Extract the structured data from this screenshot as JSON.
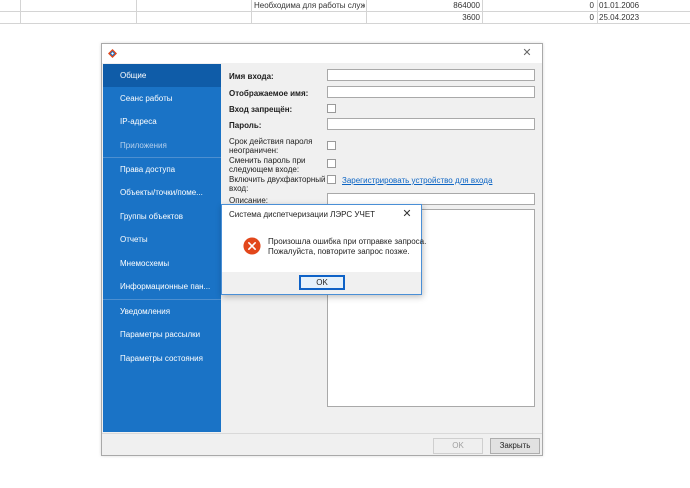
{
  "background_table": {
    "rows": [
      {
        "description": "Необходима для работы службы...",
        "value1": "864000",
        "value2": "0",
        "date": "01.01.2006"
      },
      {
        "description": "",
        "value1": "3600",
        "value2": "0",
        "date": "25.04.2023"
      }
    ]
  },
  "dialog": {
    "sidebar": [
      {
        "label": "Общие",
        "state": "active"
      },
      {
        "label": "Сеанс работы",
        "state": "normal"
      },
      {
        "label": "IP-адреса",
        "state": "normal"
      },
      {
        "label": "Приложения",
        "state": "disabled"
      },
      {
        "label": "Права доступа",
        "state": "normal"
      },
      {
        "label": "Объекты/точки/поме...",
        "state": "normal"
      },
      {
        "label": "Группы объектов",
        "state": "normal"
      },
      {
        "label": "Отчеты",
        "state": "normal"
      },
      {
        "label": "Мнемосхемы",
        "state": "normal"
      },
      {
        "label": "Информационные пан...",
        "state": "normal"
      },
      {
        "label": "Уведомления",
        "state": "normal"
      },
      {
        "label": "Параметры рассылки",
        "state": "normal"
      },
      {
        "label": "Параметры состояния",
        "state": "normal"
      }
    ],
    "form": {
      "login_label": "Имя входа:",
      "login_value": "",
      "display_name_label": "Отображаемое имя:",
      "display_name_value": "",
      "login_disabled_label": "Вход запрещён:",
      "password_label": "Пароль:",
      "password_value": "",
      "password_unlimited_label_l1": "Срок действия пароля",
      "password_unlimited_label_l2": "неограничен:",
      "change_password_label_l1": "Сменить пароль при",
      "change_password_label_l2": "следующем входе:",
      "two_factor_label_l1": "Включить двухфакторный",
      "two_factor_label_l2": "вход:",
      "register_device_link": "Зарегистрировать устройство для входа",
      "description_label": "Описание:",
      "description_value": ""
    },
    "footer": {
      "ok_label": "OK",
      "close_label": "Закрыть"
    }
  },
  "message_box": {
    "title": "Система диспетчеризации ЛЭРС УЧЕТ",
    "message_line1": "Произошла ошибка при отправке запроса.",
    "message_line2": "Пожалуйста, повторите запрос позже.",
    "ok_label": "OK",
    "icon": "error-icon"
  },
  "colors": {
    "sidebar_bg": "#1a73c6",
    "sidebar_active": "#0f5ca8",
    "link": "#0b64c4",
    "error_icon": "#e2471b",
    "focus_border": "#0e62c7"
  }
}
